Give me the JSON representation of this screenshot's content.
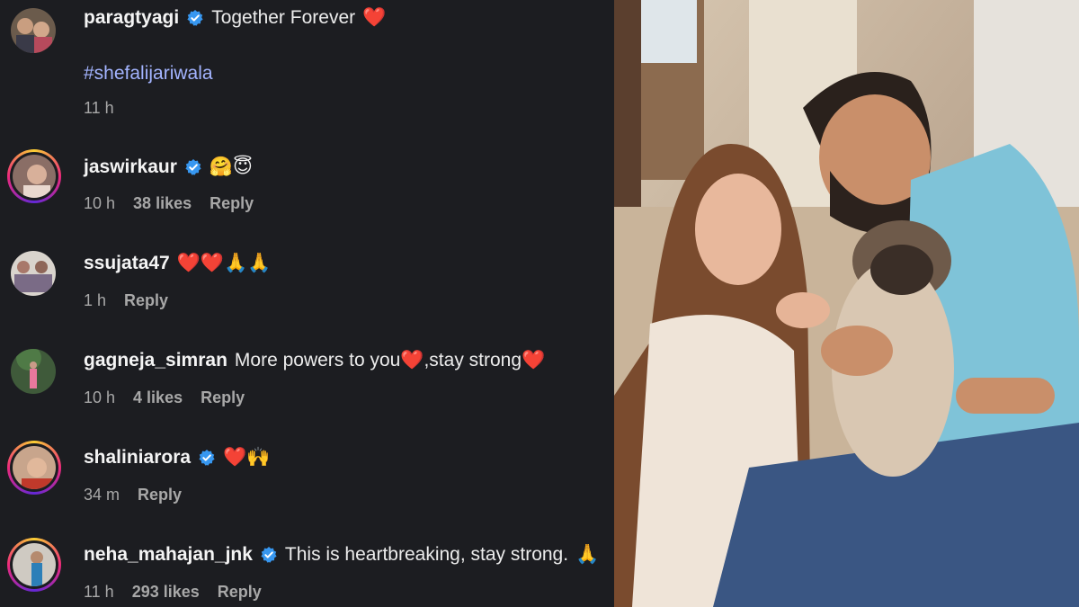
{
  "comments": [
    {
      "username": "paragtyagi",
      "verified": true,
      "text": "Together Forever",
      "emoji": "❤️",
      "hashtag": "#shefalijariwala",
      "time": "11 h"
    },
    {
      "username": "jaswirkaur",
      "verified": true,
      "text": "",
      "emoji": "🤗😇",
      "time": "10 h",
      "likes": "38 likes",
      "reply": "Reply"
    },
    {
      "username": "ssujata47",
      "verified": false,
      "text": "",
      "emoji": "❤️❤️🙏🙏",
      "time": "1 h",
      "reply": "Reply"
    },
    {
      "username": "gagneja_simran",
      "verified": false,
      "text": "More powers to you❤️,stay strong❤️",
      "time": "10 h",
      "likes": "4 likes",
      "reply": "Reply"
    },
    {
      "username": "shaliniarora",
      "verified": true,
      "text": "",
      "emoji": "❤️🙌",
      "time": "34 m",
      "reply": "Reply"
    },
    {
      "username": "neha_mahajan_jnk",
      "verified": true,
      "text": "This is heartbreaking, stay strong.",
      "emoji": "🙏",
      "time": "11 h",
      "likes": "293 likes",
      "reply": "Reply"
    }
  ],
  "colors": {
    "background": "#1c1d21",
    "hashtag": "#a3b4ff",
    "verified": "#3797f0",
    "meta": "#a8a8a8"
  },
  "icons": {
    "verified": "verified-badge-icon"
  }
}
